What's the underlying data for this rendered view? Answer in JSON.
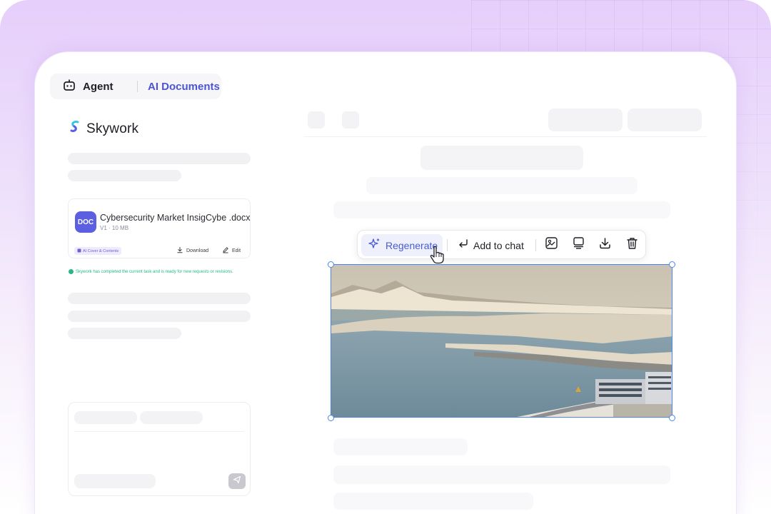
{
  "tabs": {
    "agent_label": "Agent",
    "docs_label": "AI Documents"
  },
  "brand": {
    "name": "Skywork"
  },
  "file": {
    "badge": "DOC",
    "name": "Cybersecurity Market InsigCybe .docx",
    "version": "V1",
    "size": "10 MB",
    "tag": "AI Cover & Contents",
    "download_label": "Download",
    "edit_label": "Edit"
  },
  "status": {
    "message": "Skywork has completed the current task and is ready for new requests or revisions."
  },
  "toolbar": {
    "regenerate_label": "Regenerate",
    "add_to_chat_label": "Add to chat"
  },
  "icons": {
    "agent": "robot-icon",
    "regenerate": "sparkle-icon",
    "add_to_chat": "return-arrow-icon",
    "image_edit": "image-edit-icon",
    "layout": "layout-icon",
    "download": "download-icon",
    "delete": "trash-icon",
    "send": "send-icon",
    "cursor": "hand-pointer-icon"
  },
  "colors": {
    "accent": "#4b55d4",
    "doc_badge": "#5b5fe0",
    "status": "#27b886",
    "selection": "#4a86e8"
  }
}
